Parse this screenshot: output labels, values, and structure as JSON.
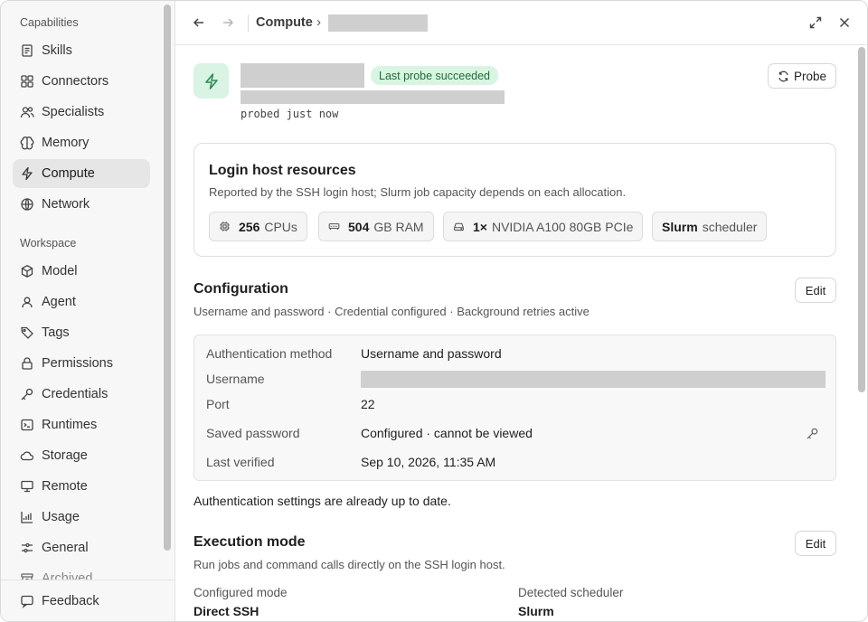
{
  "sidebar": {
    "capabilities_heading": "Capabilities",
    "capabilities": [
      {
        "label": "Skills",
        "icon": "skills-icon"
      },
      {
        "label": "Connectors",
        "icon": "connectors-icon"
      },
      {
        "label": "Specialists",
        "icon": "specialists-icon"
      },
      {
        "label": "Memory",
        "icon": "memory-icon"
      },
      {
        "label": "Compute",
        "icon": "bolt-icon",
        "active": true
      },
      {
        "label": "Network",
        "icon": "globe-icon"
      }
    ],
    "workspace_heading": "Workspace",
    "workspace": [
      {
        "label": "Model",
        "icon": "cube-icon"
      },
      {
        "label": "Agent",
        "icon": "agent-icon"
      },
      {
        "label": "Tags",
        "icon": "tag-icon"
      },
      {
        "label": "Permissions",
        "icon": "lock-icon"
      },
      {
        "label": "Credentials",
        "icon": "key-icon"
      },
      {
        "label": "Runtimes",
        "icon": "terminal-icon"
      },
      {
        "label": "Storage",
        "icon": "cloud-icon"
      },
      {
        "label": "Remote",
        "icon": "remote-icon"
      },
      {
        "label": "Usage",
        "icon": "chart-icon"
      },
      {
        "label": "General",
        "icon": "sliders-icon"
      },
      {
        "label": "Archived",
        "icon": "archive-icon"
      }
    ],
    "feedback_label": "Feedback"
  },
  "header": {
    "breadcrumb_parent": "Compute"
  },
  "main": {
    "status_badge": "Last probe succeeded",
    "probed_text": "probed just now",
    "probe_button": "Probe",
    "resources": {
      "title": "Login host resources",
      "subtitle": "Reported by the SSH login host; Slurm job capacity depends on each allocation.",
      "chips": [
        {
          "value": "256",
          "unit": "CPUs",
          "icon": "cpu-icon"
        },
        {
          "value": "504",
          "unit": "GB RAM",
          "icon": "memory-chip-icon"
        },
        {
          "value": "1×",
          "unit": "NVIDIA A100 80GB PCIe",
          "icon": "gpu-icon"
        },
        {
          "value": "Slurm",
          "unit": "scheduler",
          "icon": ""
        }
      ]
    },
    "configuration": {
      "title": "Configuration",
      "subtitle": "Username and password · Credential configured · Background retries active",
      "edit_button": "Edit",
      "rows": [
        {
          "label": "Authentication method",
          "value": "Username and password"
        },
        {
          "label": "Username",
          "value": ""
        },
        {
          "label": "Port",
          "value": "22"
        },
        {
          "label": "Saved password",
          "value": "Configured · cannot be viewed"
        },
        {
          "label": "Last verified",
          "value": "Sep 10, 2026, 11:35 AM"
        }
      ],
      "note": "Authentication settings are already up to date."
    },
    "execution": {
      "title": "Execution mode",
      "subtitle": "Run jobs and command calls directly on the SSH login host.",
      "edit_button": "Edit",
      "configured_mode_label": "Configured mode",
      "configured_mode_value": "Direct SSH",
      "detected_scheduler_label": "Detected scheduler",
      "detected_scheduler_value": "Slurm"
    }
  },
  "colors": {
    "accent_green_bg": "#d9f3e4",
    "accent_green_fg": "#1f6b3c",
    "sidebar_bg": "#f7f7f7",
    "active_item_bg": "#e6e6e6"
  }
}
